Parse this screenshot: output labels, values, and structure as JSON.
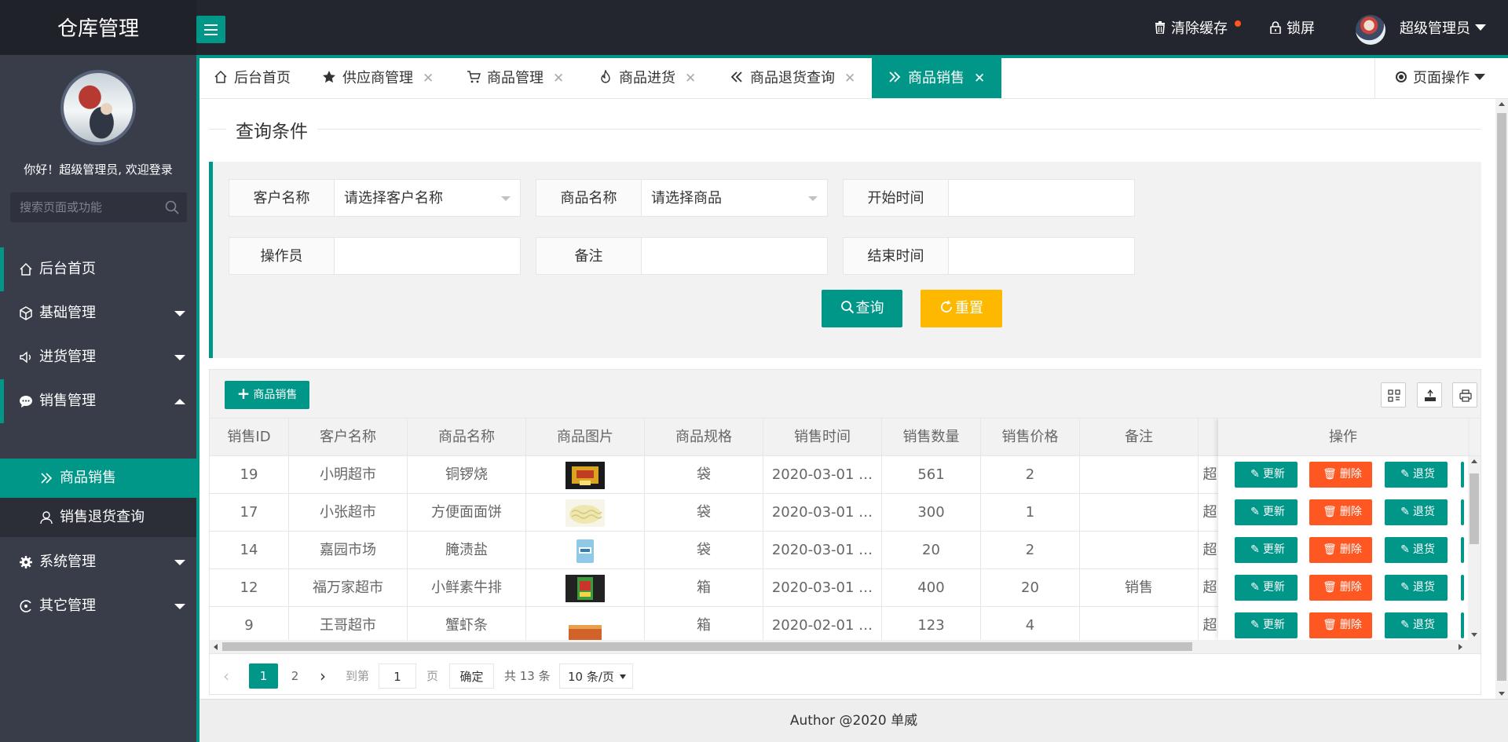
{
  "app": {
    "title": "仓库管理"
  },
  "header": {
    "clear_cache": "清除缓存",
    "lock_screen": "锁屏",
    "user_name": "超级管理员"
  },
  "sidebar": {
    "welcome": "你好！超级管理员, 欢迎登录",
    "search_placeholder": "搜索页面或功能",
    "items": [
      {
        "label": "后台首页",
        "icon": "home-icon"
      },
      {
        "label": "基础管理",
        "icon": "cube-icon"
      },
      {
        "label": "进货管理",
        "icon": "speaker-icon"
      },
      {
        "label": "销售管理",
        "icon": "chat-icon",
        "expanded": true,
        "children": [
          {
            "label": "商品销售",
            "active": true,
            "icon": "double-chevron-icon"
          },
          {
            "label": "销售退货查询",
            "icon": "user-icon"
          }
        ]
      },
      {
        "label": "系统管理",
        "icon": "gear-icon"
      },
      {
        "label": "其它管理",
        "icon": "circle-icon"
      }
    ]
  },
  "tabs": [
    {
      "label": "后台首页",
      "icon": "home-icon",
      "closable": false
    },
    {
      "label": "供应商管理",
      "icon": "star-icon",
      "closable": true
    },
    {
      "label": "商品管理",
      "icon": "cart-icon",
      "closable": true
    },
    {
      "label": "商品进货",
      "icon": "fire-icon",
      "closable": true
    },
    {
      "label": "商品退货查询",
      "icon": "double-chevron-left-icon",
      "closable": true
    },
    {
      "label": "商品销售",
      "icon": "double-chevron-right-icon",
      "closable": true,
      "active": true
    }
  ],
  "page_ops": "页面操作",
  "query": {
    "legend": "查询条件",
    "customer_label": "客户名称",
    "customer_placeholder": "请选择客户名称",
    "goods_label": "商品名称",
    "goods_placeholder": "请选择商品",
    "start_label": "开始时间",
    "start_value": "",
    "operator_label": "操作员",
    "operator_value": "",
    "remark_label": "备注",
    "remark_value": "",
    "end_label": "结束时间",
    "end_value": "",
    "query_button": "查询",
    "reset_button": "重置"
  },
  "table": {
    "add_button": "商品销售",
    "columns": [
      "销售ID",
      "客户名称",
      "商品名称",
      "商品图片",
      "商品规格",
      "销售时间",
      "销售数量",
      "销售价格",
      "备注",
      "",
      "操作"
    ],
    "rows": [
      {
        "id": "19",
        "customer": "小明超市",
        "goods": "铜锣烧",
        "image": "dorayaki-image",
        "spec": "袋",
        "time": "2020-03-01 …",
        "qty": "561",
        "price": "2",
        "remark": "",
        "operator": "超"
      },
      {
        "id": "17",
        "customer": "小张超市",
        "goods": "方便面面饼",
        "image": "noodle-image",
        "spec": "袋",
        "time": "2020-03-01 …",
        "qty": "300",
        "price": "1",
        "remark": "",
        "operator": "超"
      },
      {
        "id": "14",
        "customer": "嘉园市场",
        "goods": "腌渍盐",
        "image": "salt-image",
        "spec": "袋",
        "time": "2020-03-01 …",
        "qty": "20",
        "price": "2",
        "remark": "",
        "operator": "超"
      },
      {
        "id": "12",
        "customer": "福万家超市",
        "goods": "小鲜素牛排",
        "image": "steak-image",
        "spec": "箱",
        "time": "2020-03-01 …",
        "qty": "400",
        "price": "20",
        "remark": "销售",
        "operator": "超"
      },
      {
        "id": "9",
        "customer": "王哥超市",
        "goods": "蟹虾条",
        "image": "crab-stick-image",
        "spec": "箱",
        "time": "2020-02-01 …",
        "qty": "123",
        "price": "4",
        "remark": "",
        "operator": "超"
      }
    ],
    "op_update": "更新",
    "op_delete": "删除",
    "op_return": "退货"
  },
  "pager": {
    "current": "1",
    "page2": "2",
    "goto_label": "到第",
    "goto_value": "1",
    "page_label": "页",
    "confirm": "确定",
    "total": "共 13 条",
    "page_size": "10 条/页"
  },
  "footer": "Author @2020 单威",
  "colors": {
    "accent": "#009688",
    "warning": "#ffb800",
    "danger": "#ff5722",
    "header_bg": "#23262e",
    "sidebar_bg": "#393d49"
  }
}
